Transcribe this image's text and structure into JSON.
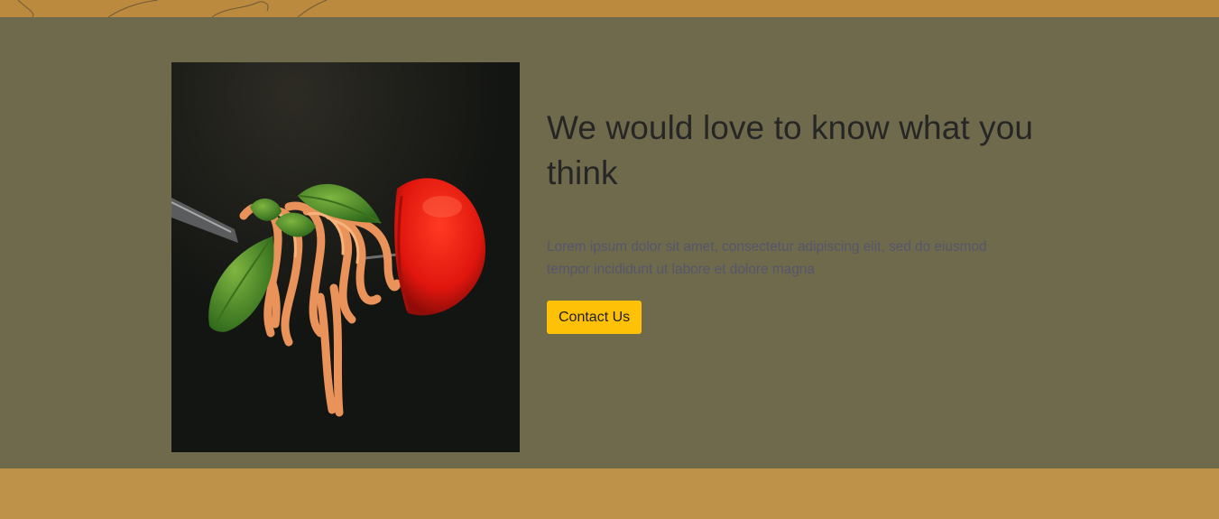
{
  "feedback": {
    "heading": "We would love to know what you think",
    "body": "Lorem ipsum dolor sit amet, consectetur adipiscing elit, sed do eiusmod tempor incididunt ut labore et dolore magna",
    "cta_label": "Contact Us",
    "image_subject": "spaghetti twirled on a fork with basil leaves and a cherry tomato"
  },
  "colors": {
    "page_background": "#bf9249",
    "section_background": "#6f6a4c",
    "button_background": "#ffc107",
    "heading_text": "#262626",
    "body_text": "#55566b"
  },
  "icons": {
    "top_strip_decoration": "line-art-illustration"
  }
}
